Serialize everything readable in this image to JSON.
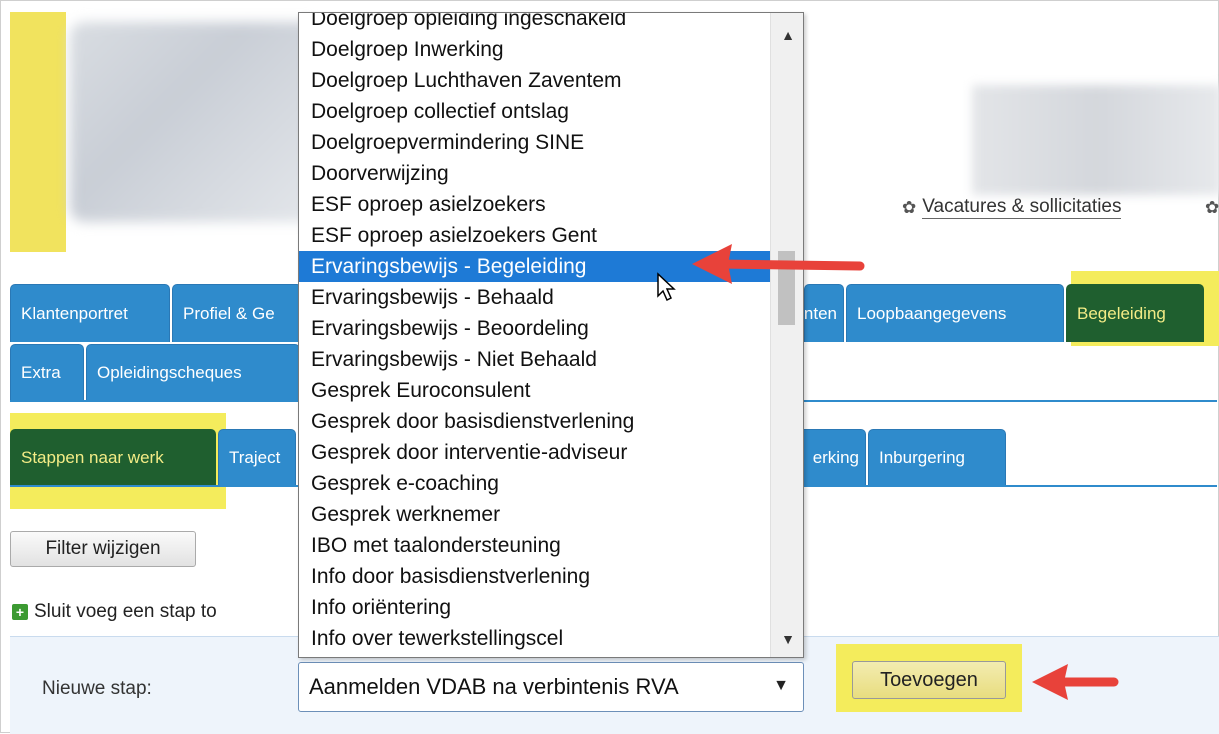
{
  "header": {
    "link_label": "Vacatures & sollicitaties",
    "link_icon": "gear-icon"
  },
  "tabs_row1": [
    {
      "label": "Klantenportret"
    },
    {
      "label": "Profiel & Ge"
    },
    {
      "label": "nten"
    },
    {
      "label": "Loopbaangegevens"
    },
    {
      "label": "Begeleiding",
      "active": true
    }
  ],
  "tabs_row2": [
    {
      "label": "Extra"
    },
    {
      "label": "Opleidingscheques"
    }
  ],
  "tabs_row3": [
    {
      "label": "Stappen naar werk",
      "active": true
    },
    {
      "label": "Traject"
    },
    {
      "label": "erking"
    },
    {
      "label": "Inburgering"
    }
  ],
  "filter_button": "Filter wijzigen",
  "add_step_text": "Sluit voeg een stap to",
  "new_step": {
    "label": "Nieuwe stap:",
    "selected_value": "Aanmelden VDAB na verbintenis RVA",
    "submit_label": "Toevoegen"
  },
  "dropdown_options": [
    "Doelgroep opleiding ingeschakeld",
    "Doelgroep Inwerking",
    "Doelgroep Luchthaven Zaventem",
    "Doelgroep collectief ontslag",
    "Doelgroepvermindering SINE",
    "Doorverwijzing",
    "ESF oproep asielzoekers",
    "ESF oproep asielzoekers Gent",
    "Ervaringsbewijs - Begeleiding",
    "Ervaringsbewijs - Behaald",
    "Ervaringsbewijs - Beoordeling",
    "Ervaringsbewijs - Niet Behaald",
    "Gesprek Euroconsulent",
    "Gesprek door basisdienstverlening",
    "Gesprek door interventie-adviseur",
    "Gesprek e-coaching",
    "Gesprek werknemer",
    "IBO met taalondersteuning",
    "Info door basisdienstverlening",
    "Info oriëntering",
    "Info over tewerkstellingscel"
  ],
  "dropdown_selected": "Ervaringsbewijs - Begeleiding",
  "colors": {
    "tab_blue": "#2f8bcc",
    "active_tab": "#1f5f2f",
    "highlight_yellow": "#f4ec5c",
    "selection_blue": "#1e7ad6",
    "annotation_arrow": "#e8423a"
  }
}
